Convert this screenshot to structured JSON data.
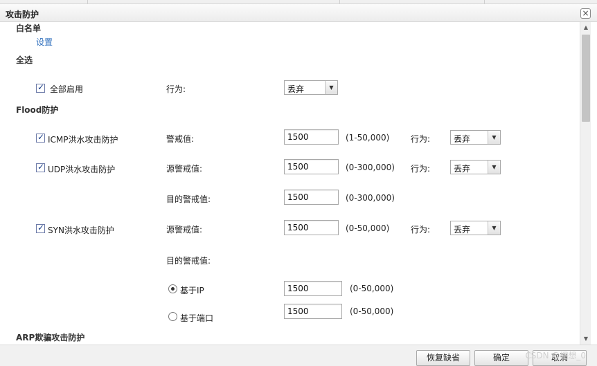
{
  "dialog": {
    "title": "攻击防护",
    "close_icon": "×"
  },
  "whitelist": {
    "section": "白名单",
    "settings_link": "设置"
  },
  "select_all": {
    "section": "全选",
    "enable_all_label": "全部启用",
    "action_label": "行为:",
    "action_value": "丢弃",
    "checked": true
  },
  "flood": {
    "section": "Flood防护",
    "icmp": {
      "label": "ICMP洪水攻击防护",
      "threshold_label": "警戒值:",
      "threshold_value": "1500",
      "range": "(1-50,000)",
      "action_label": "行为:",
      "action_value": "丢弃"
    },
    "udp": {
      "label": "UDP洪水攻击防护",
      "src_label": "源警戒值:",
      "src_value": "1500",
      "src_range": "(0-300,000)",
      "action_label": "行为:",
      "action_value": "丢弃",
      "dst_label": "目的警戒值:",
      "dst_value": "1500",
      "dst_range": "(0-300,000)"
    },
    "syn": {
      "label": "SYN洪水攻击防护",
      "src_label": "源警戒值:",
      "src_value": "1500",
      "src_range": "(0-50,000)",
      "action_label": "行为:",
      "action_value": "丢弃",
      "dst_label": "目的警戒值:",
      "ip_label": "基于IP",
      "ip_value": "1500",
      "ip_range": "(0-50,000)",
      "port_label": "基于端口",
      "port_value": "1500",
      "port_range": "(0-50,000)"
    }
  },
  "arp": {
    "section": "ARP欺骗攻击防护"
  },
  "footer": {
    "restore_default": "恢复缺省",
    "ok": "确定",
    "cancel": "取消"
  },
  "watermark": "CSDN @桐想_0"
}
